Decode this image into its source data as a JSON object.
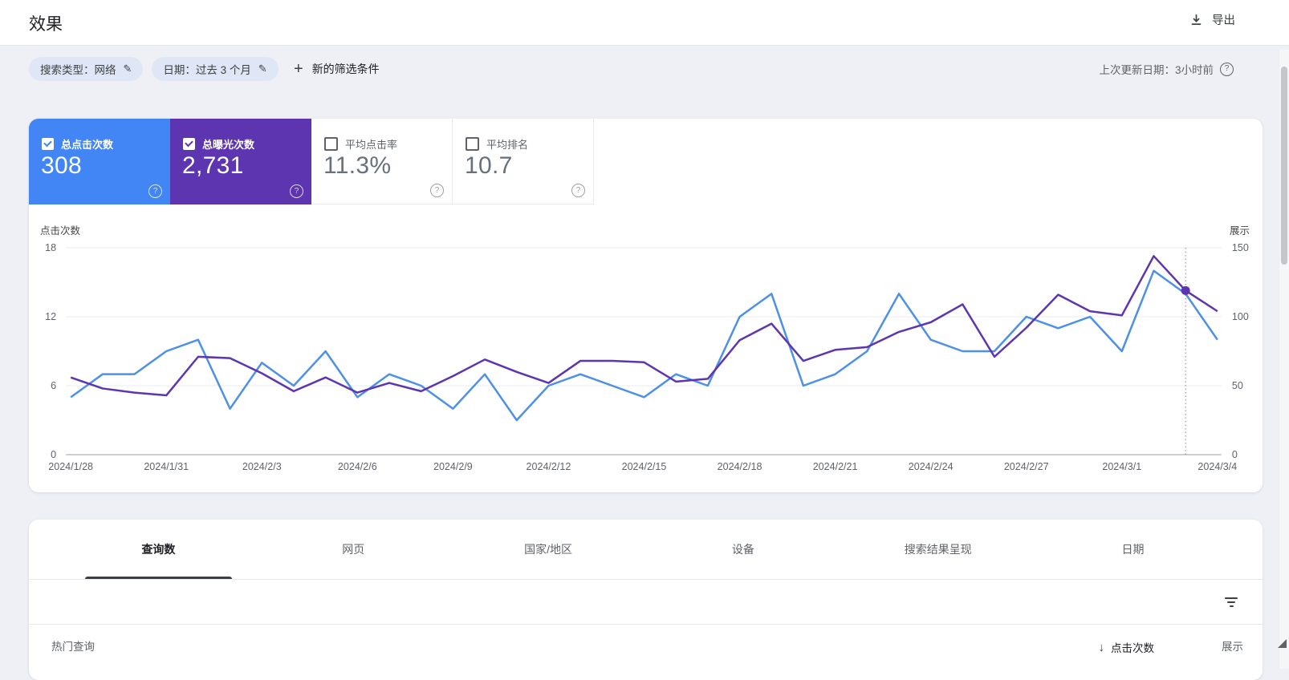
{
  "header": {
    "title": "效果",
    "export_label": "导出"
  },
  "filters": {
    "chips": [
      {
        "name": "search-type",
        "label": "搜索类型：网络"
      },
      {
        "name": "date-range",
        "label": "日期：过去 3 个月"
      }
    ],
    "add_filter_label": "新的筛选条件",
    "last_updated": "上次更新日期：3小时前"
  },
  "icons": {
    "export": "download-icon",
    "edit": "✎",
    "add": "+",
    "help": "?",
    "sort_desc": "↓",
    "filter": "filter-list-icon",
    "check": "✓"
  },
  "metrics": [
    {
      "name": "total-clicks",
      "label": "总点击次数",
      "value": "308",
      "checked": true,
      "bg": "#4285f4"
    },
    {
      "name": "total-impressions",
      "label": "总曝光次数",
      "value": "2,731",
      "checked": true,
      "bg": "#5e35b1"
    },
    {
      "name": "average-ctr",
      "label": "平均点击率",
      "value": "11.3%",
      "checked": false,
      "bg": ""
    },
    {
      "name": "average-position",
      "label": "平均排名",
      "value": "10.7",
      "checked": false,
      "bg": ""
    }
  ],
  "chart_data": {
    "type": "line",
    "title": "",
    "x": [
      "2024/1/28",
      "2024/1/29",
      "2024/1/30",
      "2024/1/31",
      "2024/2/1",
      "2024/2/2",
      "2024/2/3",
      "2024/2/4",
      "2024/2/5",
      "2024/2/6",
      "2024/2/7",
      "2024/2/8",
      "2024/2/9",
      "2024/2/10",
      "2024/2/11",
      "2024/2/12",
      "2024/2/13",
      "2024/2/14",
      "2024/2/15",
      "2024/2/16",
      "2024/2/17",
      "2024/2/18",
      "2024/2/19",
      "2024/2/20",
      "2024/2/21",
      "2024/2/22",
      "2024/2/23",
      "2024/2/24",
      "2024/2/25",
      "2024/2/26",
      "2024/2/27",
      "2024/2/28",
      "2024/2/29",
      "2024/3/1",
      "2024/3/2",
      "2024/3/3",
      "2024/3/4"
    ],
    "x_tick_interval": 3,
    "series": [
      {
        "name": "点击次数",
        "axis": "left",
        "color": "#4d90e8",
        "values": [
          5,
          7,
          7,
          9,
          10,
          4,
          8,
          6,
          9,
          5,
          7,
          6,
          4,
          7,
          3,
          6,
          7,
          6,
          5,
          7,
          6,
          12,
          14,
          6,
          7,
          9,
          14,
          10,
          9,
          9,
          12,
          11,
          12,
          9,
          16,
          14,
          10
        ]
      },
      {
        "name": "展示",
        "axis": "right",
        "color": "#5e35b1",
        "values": [
          56,
          48,
          45,
          43,
          71,
          70,
          59,
          46,
          56,
          45,
          52,
          46,
          57,
          69,
          60,
          52,
          68,
          68,
          67,
          53,
          55,
          83,
          95,
          68,
          76,
          78,
          89,
          96,
          109,
          71,
          92,
          116,
          104,
          101,
          144,
          119,
          104
        ]
      }
    ],
    "left_axis": {
      "label": "点击次数",
      "max": 18,
      "ticks": [
        18,
        12,
        6,
        0
      ]
    },
    "right_axis": {
      "label": "展示",
      "max": 150,
      "ticks": [
        150,
        100,
        50,
        0
      ]
    },
    "grid": true,
    "legend": "none",
    "hover": {
      "index": 35,
      "x": "2024/3/3",
      "clicks": 14,
      "impressions": 119
    }
  },
  "tabs": [
    {
      "name": "queries",
      "label": "查询数",
      "active": true
    },
    {
      "name": "pages",
      "label": "网页",
      "active": false
    },
    {
      "name": "countries",
      "label": "国家/地区",
      "active": false
    },
    {
      "name": "devices",
      "label": "设备",
      "active": false
    },
    {
      "name": "search-appearance",
      "label": "搜索结果呈现",
      "active": false
    },
    {
      "name": "dates",
      "label": "日期",
      "active": false
    }
  ],
  "table": {
    "row_header": "热门查询",
    "sort_column": "点击次数",
    "second_column": "展示"
  }
}
